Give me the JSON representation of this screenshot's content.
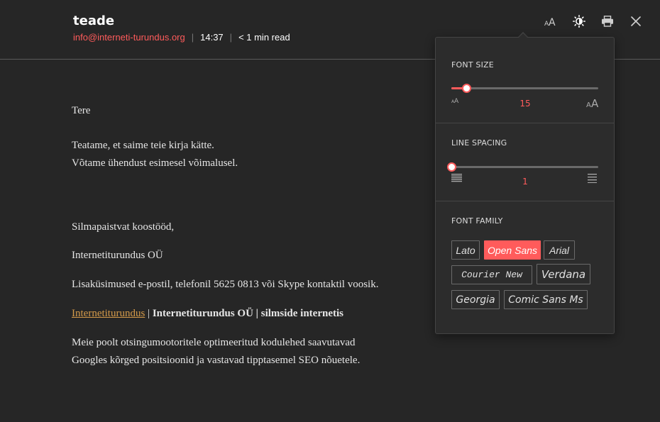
{
  "header": {
    "title": "teade",
    "email": "info@interneti-turundus.org",
    "time": "14:37",
    "read_time": "< 1 min read",
    "separator": "|"
  },
  "toolbar": {
    "icons": [
      "font-size-icon",
      "brightness-icon",
      "print-icon",
      "close-icon"
    ]
  },
  "content": {
    "greeting": "Tere",
    "line1": "Teatame, et saime teie kirja kätte.",
    "line2": "Võtame ühendust esimesel võimalusel.",
    "closing": "Silmapaistvat koostööd,",
    "company": "Internetiturundus OÜ",
    "contact": "Lisaküsimused e-postil, telefonil 5625 0813 või Skype kontaktil voosik.",
    "link_text": "Internetiturundus",
    "link_sep": " | ",
    "bold_text": "Internetiturundus OÜ | silmside internetis",
    "promo1": "Meie poolt otsingumootoritele optimeeritud kodulehed saavutavad",
    "promo2": "Googles kõrged positsioonid ja vastavad tipptasemel SEO nõuetele."
  },
  "panel": {
    "font_size": {
      "title": "FONT SIZE",
      "value": "15",
      "position": 0.1
    },
    "line_spacing": {
      "title": "LINE SPACING",
      "value": "1",
      "position": 0.0
    },
    "font_family": {
      "title": "FONT FAMILY",
      "options": [
        "Lato",
        "Open Sans",
        "Arial",
        "Courier New",
        "Verdana",
        "Georgia",
        "Comic Sans Ms"
      ],
      "selected": "Open Sans"
    }
  },
  "colors": {
    "accent": "#ff5b5b",
    "link": "#d49a4a",
    "background": "#262626",
    "panel": "#2c2c2c"
  }
}
